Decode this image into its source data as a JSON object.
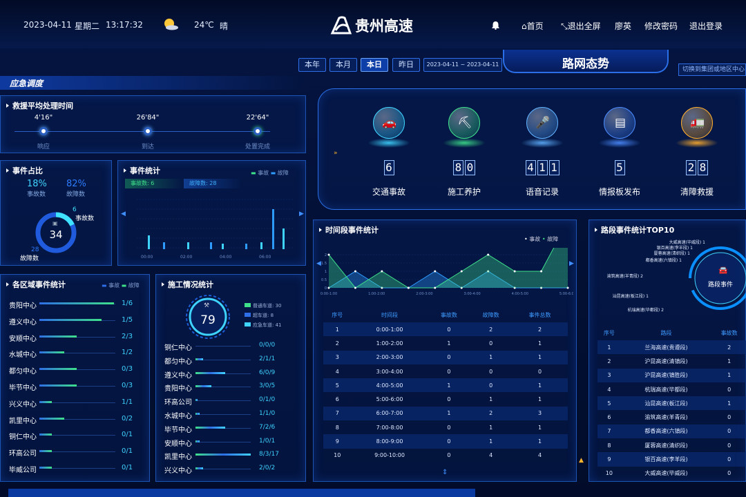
{
  "header": {
    "date": "2023-04-11",
    "weekday": "星期二",
    "time": "13:17:32",
    "temperature": "24℃",
    "weather": "晴",
    "logo_text": "贵州高速",
    "nav": {
      "bell": "",
      "home": "首页",
      "exit_fullscreen": "退出全屏",
      "user": "廖英",
      "change_password": "修改密码",
      "logout": "退出登录"
    }
  },
  "date_tabs": [
    "本年",
    "本月",
    "本日",
    "昨日"
  ],
  "date_range": "2023-04-11 ~ 2023-04-11",
  "center_title": "路网态势",
  "switch_label": "切换到集团或地区中心",
  "section_title": "应急调度",
  "rescue": {
    "title": "救援平均处理时间",
    "steps": [
      {
        "time": "4'16\"",
        "label": "响应"
      },
      {
        "time": "26'84\"",
        "label": "到达"
      },
      {
        "time": "22'64\"",
        "label": "处置完成"
      }
    ]
  },
  "ratio": {
    "title": "事件占比",
    "accident_pct": "18%",
    "accident_label": "事故数",
    "fault_pct": "82%",
    "fault_label": "故障数",
    "total": "34",
    "accident_count": "6",
    "accident_count_label": "事故数",
    "fault_count": "28",
    "fault_count_label": "故障数",
    "accident_fraction": 0.18
  },
  "event_stats": {
    "title": "事件统计",
    "legend": [
      "事故",
      "故障"
    ],
    "accident_summary": "事故数: 6",
    "fault_summary": "故障数: 28"
  },
  "stats_row": [
    {
      "value": "6",
      "label": "交通事故",
      "color": "#3fd3ff"
    },
    {
      "value": "80",
      "label": "施工养护",
      "color": "#3ee08a"
    },
    {
      "value": "411",
      "label": "语音记录",
      "color": "#5fb0ff"
    },
    {
      "value": "5",
      "label": "情报板发布",
      "color": "#4b8bff"
    },
    {
      "value": "28",
      "label": "清障救援",
      "color": "#ffae2e"
    }
  ],
  "region": {
    "title": "各区域事件统计",
    "legend": [
      "事故",
      "故障"
    ],
    "rows": [
      {
        "name": "贵阳中心",
        "value": "1/6",
        "fault": 6
      },
      {
        "name": "遵义中心",
        "value": "1/5",
        "fault": 5
      },
      {
        "name": "安顺中心",
        "value": "2/3",
        "fault": 3
      },
      {
        "name": "水城中心",
        "value": "1/2",
        "fault": 2
      },
      {
        "name": "都匀中心",
        "value": "0/3",
        "fault": 3
      },
      {
        "name": "毕节中心",
        "value": "0/3",
        "fault": 3
      },
      {
        "name": "兴义中心",
        "value": "1/1",
        "fault": 1
      },
      {
        "name": "凯里中心",
        "value": "0/2",
        "fault": 2
      },
      {
        "name": "铜仁中心",
        "value": "0/1",
        "fault": 1
      },
      {
        "name": "环高公司",
        "value": "0/1",
        "fault": 1
      },
      {
        "name": "毕威公司",
        "value": "0/1",
        "fault": 1
      }
    ]
  },
  "construction": {
    "title": "施工情况统计",
    "total": "79",
    "legend": [
      {
        "label": "普通车道: 30",
        "color": "#3ee08a"
      },
      {
        "label": "超车道: 8",
        "color": "#2e6ee6"
      },
      {
        "label": "应急车道: 41",
        "color": "#3fd3ff"
      }
    ],
    "rows": [
      {
        "name": "铜仁中心",
        "value": "0/0/0",
        "size": 0
      },
      {
        "name": "都匀中心",
        "value": "2/1/1",
        "size": 4
      },
      {
        "name": "遵义中心",
        "value": "6/0/9",
        "size": 15
      },
      {
        "name": "贵阳中心",
        "value": "3/0/5",
        "size": 8
      },
      {
        "name": "环高公司",
        "value": "0/1/0",
        "size": 1
      },
      {
        "name": "水城中心",
        "value": "1/1/0",
        "size": 2
      },
      {
        "name": "毕节中心",
        "value": "7/2/6",
        "size": 15
      },
      {
        "name": "安顺中心",
        "value": "1/0/1",
        "size": 2
      },
      {
        "name": "凯里中心",
        "value": "8/3/17",
        "size": 28
      },
      {
        "name": "兴义中心",
        "value": "2/0/2",
        "size": 4
      }
    ]
  },
  "time_stats": {
    "title": "时间段事件统计",
    "legend": [
      "事故",
      "故障"
    ],
    "headers": [
      "序号",
      "时间段",
      "事故数",
      "故障数",
      "事件总数"
    ],
    "rows": [
      [
        "1",
        "0:00-1:00",
        "0",
        "2",
        "2"
      ],
      [
        "2",
        "1:00-2:00",
        "1",
        "0",
        "1"
      ],
      [
        "3",
        "2:00-3:00",
        "0",
        "1",
        "1"
      ],
      [
        "4",
        "3:00-4:00",
        "0",
        "0",
        "0"
      ],
      [
        "5",
        "4:00-5:00",
        "1",
        "0",
        "1"
      ],
      [
        "6",
        "5:00-6:00",
        "0",
        "1",
        "1"
      ],
      [
        "7",
        "6:00-7:00",
        "1",
        "2",
        "3"
      ],
      [
        "8",
        "7:00-8:00",
        "0",
        "1",
        "1"
      ],
      [
        "9",
        "8:00-9:00",
        "0",
        "1",
        "1"
      ],
      [
        "10",
        "9:00-10:00",
        "0",
        "4",
        "4"
      ]
    ]
  },
  "top10": {
    "title": "路段事件统计TOP10",
    "center_label": "路段事件",
    "ring_labels": [
      "大威高速(毕威段) 1",
      "银百高速(李羊段) 1",
      "厦蓉高速(清织段) 1",
      "都香高速(六镇段) 1",
      "渝筑高速(羊青段) 2",
      "汕昆高速(板江段) 1",
      "杭瑞高速(毕都段) 2"
    ],
    "headers": [
      "序号",
      "路段",
      "事故数"
    ],
    "rows": [
      [
        "1",
        "兰海高速(贵遵段)",
        "2"
      ],
      [
        "2",
        "沪昆高速(清镇段)",
        "1"
      ],
      [
        "3",
        "沪昆高速(镇胜段)",
        "1"
      ],
      [
        "4",
        "杭瑞高速(毕都段)",
        "0"
      ],
      [
        "5",
        "汕昆高速(板江段)",
        "1"
      ],
      [
        "6",
        "渝筑高速(羊青段)",
        "0"
      ],
      [
        "7",
        "都香高速(六镇段)",
        "0"
      ],
      [
        "8",
        "厦蓉高速(清织段)",
        "0"
      ],
      [
        "9",
        "银百高速(李羊段)",
        "0"
      ],
      [
        "10",
        "大威高速(毕威段)",
        "0"
      ]
    ]
  },
  "chart_data": [
    {
      "type": "bar",
      "title": "事件统计",
      "x": [
        "00:00",
        "02:00",
        "04:00",
        "06:00"
      ],
      "series": [
        {
          "name": "事故"
        },
        {
          "name": "故障"
        }
      ]
    },
    {
      "type": "area",
      "title": "时间段事件统计",
      "x": [
        "0:00-1:00",
        "1:00-2:00",
        "2:00-3:00",
        "3:00-4:00",
        "4:00-5:00",
        "5:00-6:00",
        "6:00-7:00",
        "7:00-8:00",
        "8:00-9:00",
        "9:00-10:00"
      ],
      "x_ticks": [
        "0:00-1:00",
        "1:00-2:00",
        "2:00-3:00",
        "3:00-4:00",
        "4:00-5:00",
        "5:00-6:00"
      ],
      "y_ticks": [
        "0",
        "0.5",
        "1",
        "1.5",
        "2"
      ],
      "ylim": [
        0,
        2
      ],
      "series": [
        {
          "name": "事故",
          "values": [
            0,
            1,
            0,
            0,
            1,
            0,
            1,
            0,
            0,
            0
          ]
        },
        {
          "name": "故障",
          "values": [
            2,
            0,
            1,
            0,
            0,
            1,
            2,
            1,
            1,
            4
          ]
        }
      ]
    }
  ]
}
